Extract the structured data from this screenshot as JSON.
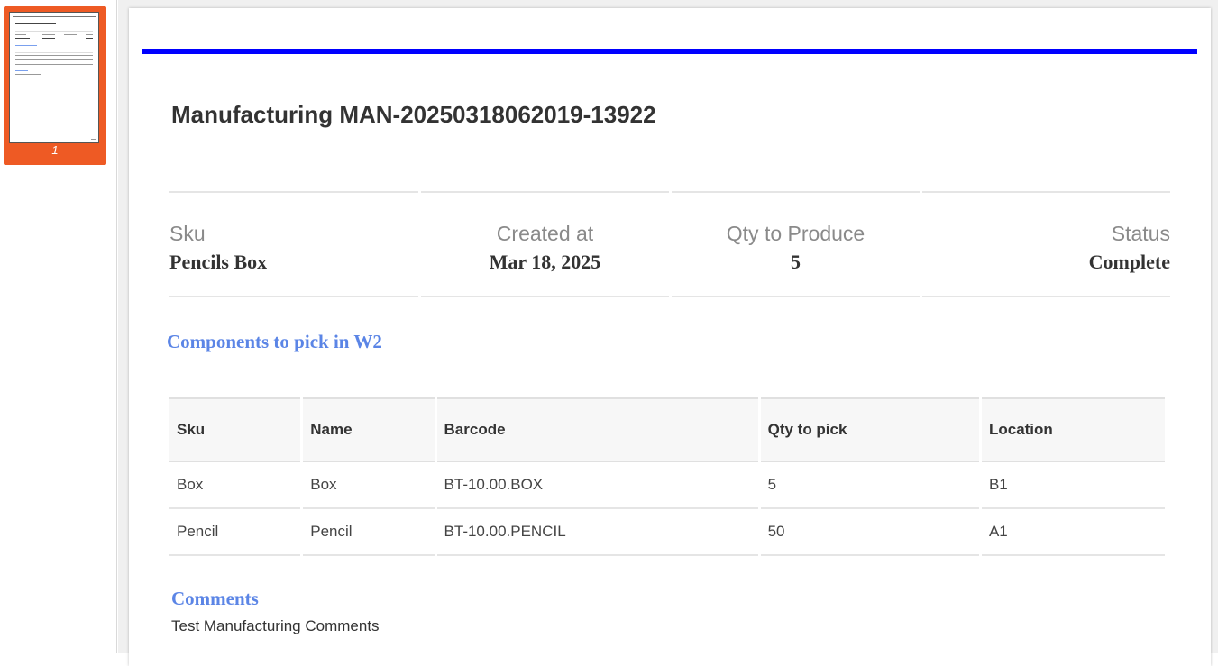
{
  "thumbnails": [
    {
      "page_number": "1",
      "active": true
    }
  ],
  "document": {
    "title": "Manufacturing MAN-20250318062019-13922",
    "info": [
      {
        "label": "Sku",
        "value": "Pencils Box",
        "align": "left"
      },
      {
        "label": "Created at",
        "value": "Mar 18, 2025",
        "align": "center"
      },
      {
        "label": "Qty to Produce",
        "value": "5",
        "align": "center"
      },
      {
        "label": "Status",
        "value": "Complete",
        "align": "right"
      }
    ],
    "components_heading": "Components to pick in W2",
    "components": {
      "headers": [
        "Sku",
        "Name",
        "Barcode",
        "Qty to pick",
        "Location"
      ],
      "rows": [
        [
          "Box",
          "Box",
          "BT-10.00.BOX",
          "5",
          "B1"
        ],
        [
          "Pencil",
          "Pencil",
          "BT-10.00.PENCIL",
          "50",
          "A1"
        ]
      ]
    },
    "comments_heading": "Comments",
    "comments": "Test Manufacturing Comments"
  },
  "colors": {
    "accent_bar": "#0000ff",
    "section_heading": "#5b85e6",
    "thumbnail_active": "#ee5a24"
  }
}
